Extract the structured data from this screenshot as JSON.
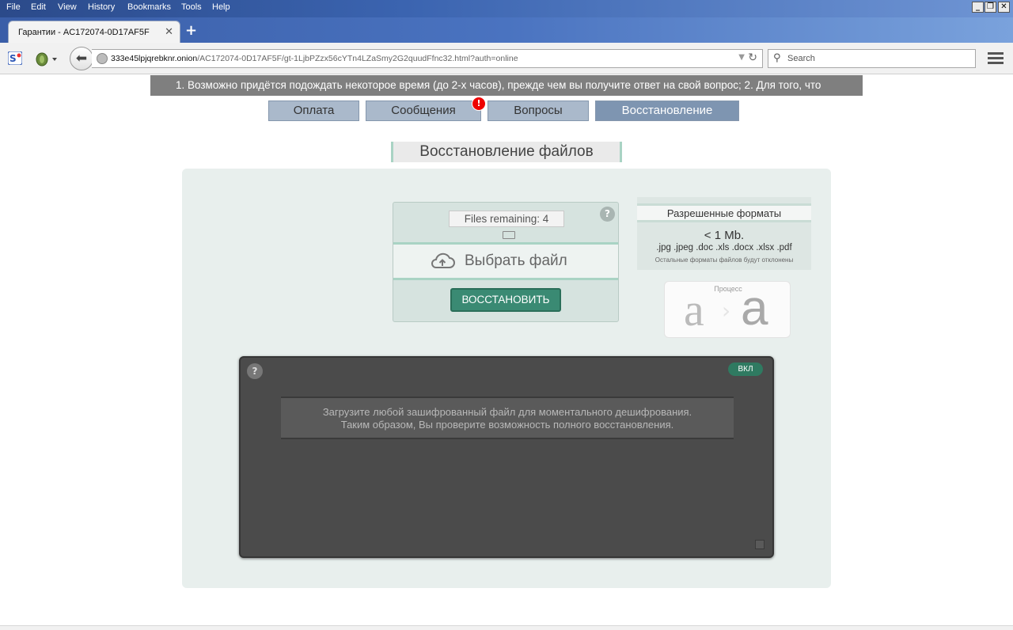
{
  "menubar": {
    "items": [
      "File",
      "Edit",
      "View",
      "History",
      "Bookmarks",
      "Tools",
      "Help"
    ]
  },
  "window_controls": {
    "minimize": "_",
    "restore": "❐",
    "close": "✕"
  },
  "tab": {
    "title": "Гарантии - AC172074-0D17AF5F",
    "close": "✕",
    "new_tab": "+"
  },
  "urlbar": {
    "host": "333e45lpjqrebknr.onion",
    "path": "/AC172074-0D17AF5F/gt-1LjbPZzx56cYTn4LZaSmy2G2quudFfnc32.html?auth=online"
  },
  "searchbar": {
    "placeholder": "Search"
  },
  "ticker": {
    "text": "1. Возможно придётся подождать некоторое время (до 2-х часов), прежде чем вы получите ответ на свой вопрос; 2. Для того, что"
  },
  "nav": {
    "payment": "Оплата",
    "messages": "Сообщения",
    "messages_alert": "!",
    "questions": "Вопросы",
    "recovery": "Восстановление"
  },
  "section_title": "Восстановление файлов",
  "upload": {
    "files_remaining": "Files remaining: 4",
    "help": "?",
    "choose_file": "Выбрать файл",
    "restore_button": "ВОССТАНОВИТЬ"
  },
  "formats": {
    "header": "Разрешенные форматы",
    "size_limit": "< 1 Mb.",
    "extensions": ".jpg .jpeg .doc .xls .docx .xlsx .pdf",
    "note": "Остальные форматы файлов будут отклонены"
  },
  "process": {
    "label": "Процесс",
    "glyph_from": "a",
    "glyph_to": "a"
  },
  "console": {
    "help": "?",
    "toggle_label": "ВКЛ",
    "message_line1": "Загрузите любой зашифрованный файл для моментального дешифрования.",
    "message_line2": "Таким образом, Вы проверите возможность полного восстановления."
  },
  "colors": {
    "accent_green": "#3a8a73",
    "nav_button": "#aab9cb",
    "nav_active": "#7e95b1",
    "alert_red": "#ee0000"
  }
}
